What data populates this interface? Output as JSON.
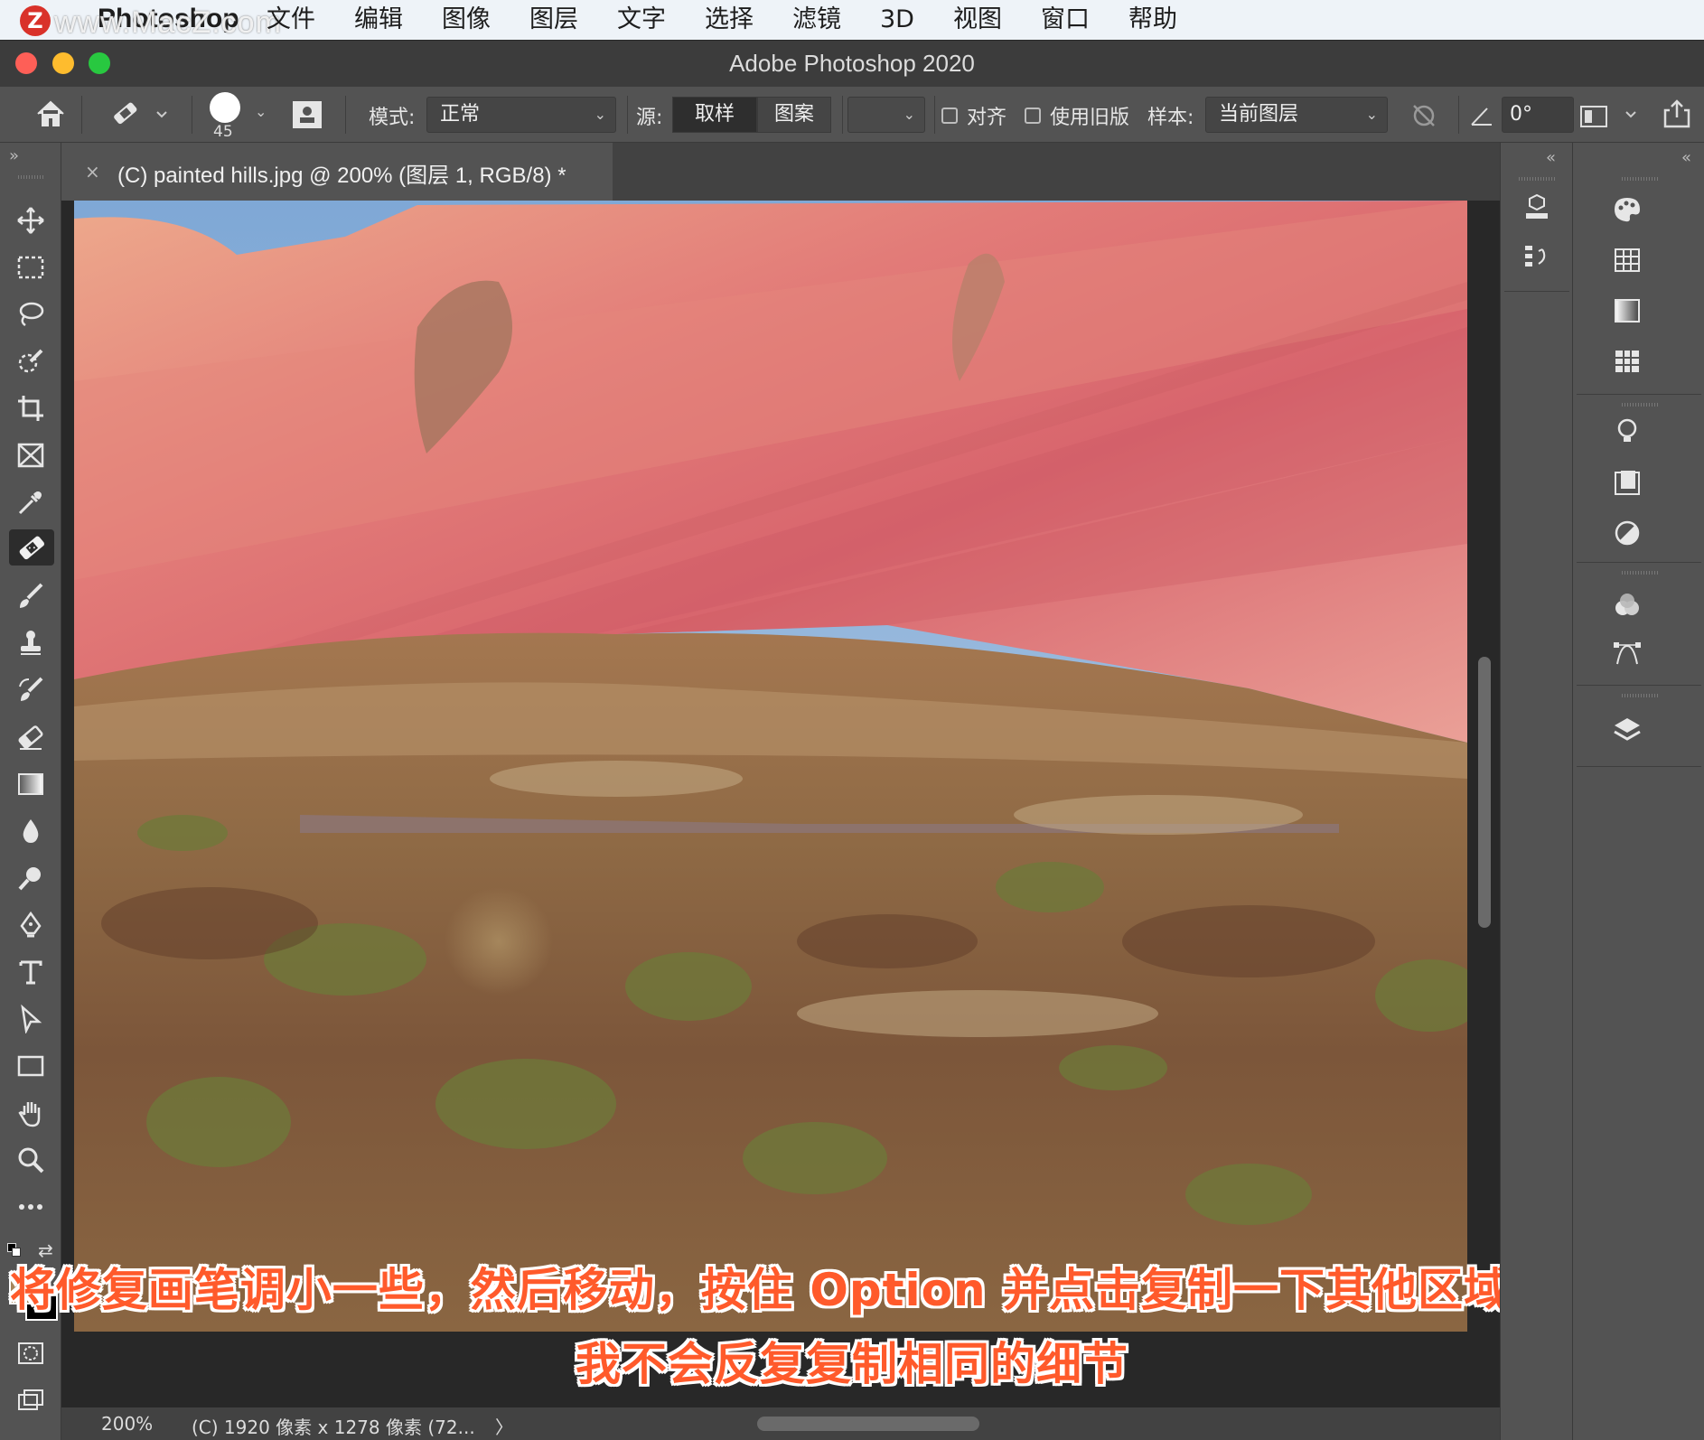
{
  "menubar": {
    "app_name": "Photoshop",
    "items": [
      "文件",
      "编辑",
      "图像",
      "图层",
      "文字",
      "选择",
      "滤镜",
      "3D",
      "视图",
      "窗口",
      "帮助"
    ],
    "watermark": "www.MacZ.com",
    "watermark_badge": "Z"
  },
  "window": {
    "title": "Adobe Photoshop 2020"
  },
  "options": {
    "brush_size": "45",
    "mode_label": "模式:",
    "mode_value": "正常",
    "source_label": "源:",
    "source_sampled": "取样",
    "source_pattern": "图案",
    "aligned_label": "对齐",
    "legacy_label": "使用旧版",
    "sample_label": "样本:",
    "sample_value": "当前图层",
    "angle_value": "0°"
  },
  "document": {
    "tab_title": "(C) painted hills.jpg @ 200% (图层 1, RGB/8) *",
    "close_glyph": "×"
  },
  "status": {
    "zoom": "200%",
    "info": "(C) 1920 像素 x 1278 像素 (72...",
    "arrow": "〉"
  },
  "tools": [
    "move-tool",
    "marquee-tool",
    "lasso-tool",
    "quick-selection-tool",
    "crop-tool",
    "frame-tool",
    "eyedropper-tool",
    "healing-brush-tool",
    "brush-tool",
    "clone-stamp-tool",
    "history-brush-tool",
    "eraser-tool",
    "gradient-tool",
    "blur-tool",
    "dodge-tool",
    "pen-tool",
    "type-tool",
    "path-selection-tool",
    "rectangle-tool",
    "hand-tool",
    "zoom-tool",
    "edit-toolbar"
  ],
  "colors": {
    "foreground": "#a5865c",
    "background": "#000000",
    "accent": "#ff5a2b"
  },
  "subtitle": {
    "line1": "将修复画笔调小一些，然后移动，按住 Option 并点击复制一下其他区域，以确保",
    "line2": "我不会反复复制相同的细节"
  },
  "panel_collapse": {
    "left": "»",
    "right1": "«",
    "right2": "«"
  }
}
